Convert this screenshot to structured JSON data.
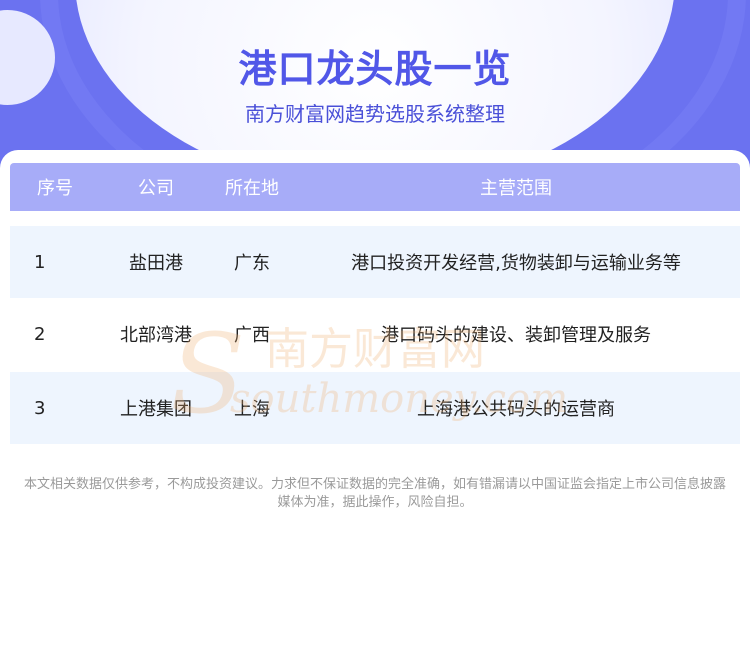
{
  "header": {
    "title": "港口龙头股一览",
    "subtitle": "南方财富网趋势选股系统整理"
  },
  "table": {
    "headers": [
      "序号",
      "公司",
      "所在地",
      "主营范围"
    ],
    "rows": [
      {
        "index": "1",
        "company": "盐田港",
        "location": "广东",
        "business": "港口投资开发经营,货物装卸与运输业务等"
      },
      {
        "index": "2",
        "company": "北部湾港",
        "location": "广西",
        "business": "港口码头的建设、装卸管理及服务"
      },
      {
        "index": "3",
        "company": "上港集团",
        "location": "上海",
        "business": "上海港公共码头的运营商"
      }
    ]
  },
  "watermark": {
    "cn": "南方财富网",
    "en": "southmoney.com"
  },
  "disclaimer": {
    "line1": "本文相关数据仅供参考，不构成投资建议。力求但不保证数据的完全准确，如有错漏请以中国证监会指定上市公司信息披露",
    "line2": "媒体为准，据此操作，风险自担。"
  },
  "colors": {
    "banner": "#6b72f0",
    "title": "#5157e8",
    "table_header": "#a7acf8",
    "alt_row": "#eef5fe",
    "watermark": "#f0b070"
  }
}
